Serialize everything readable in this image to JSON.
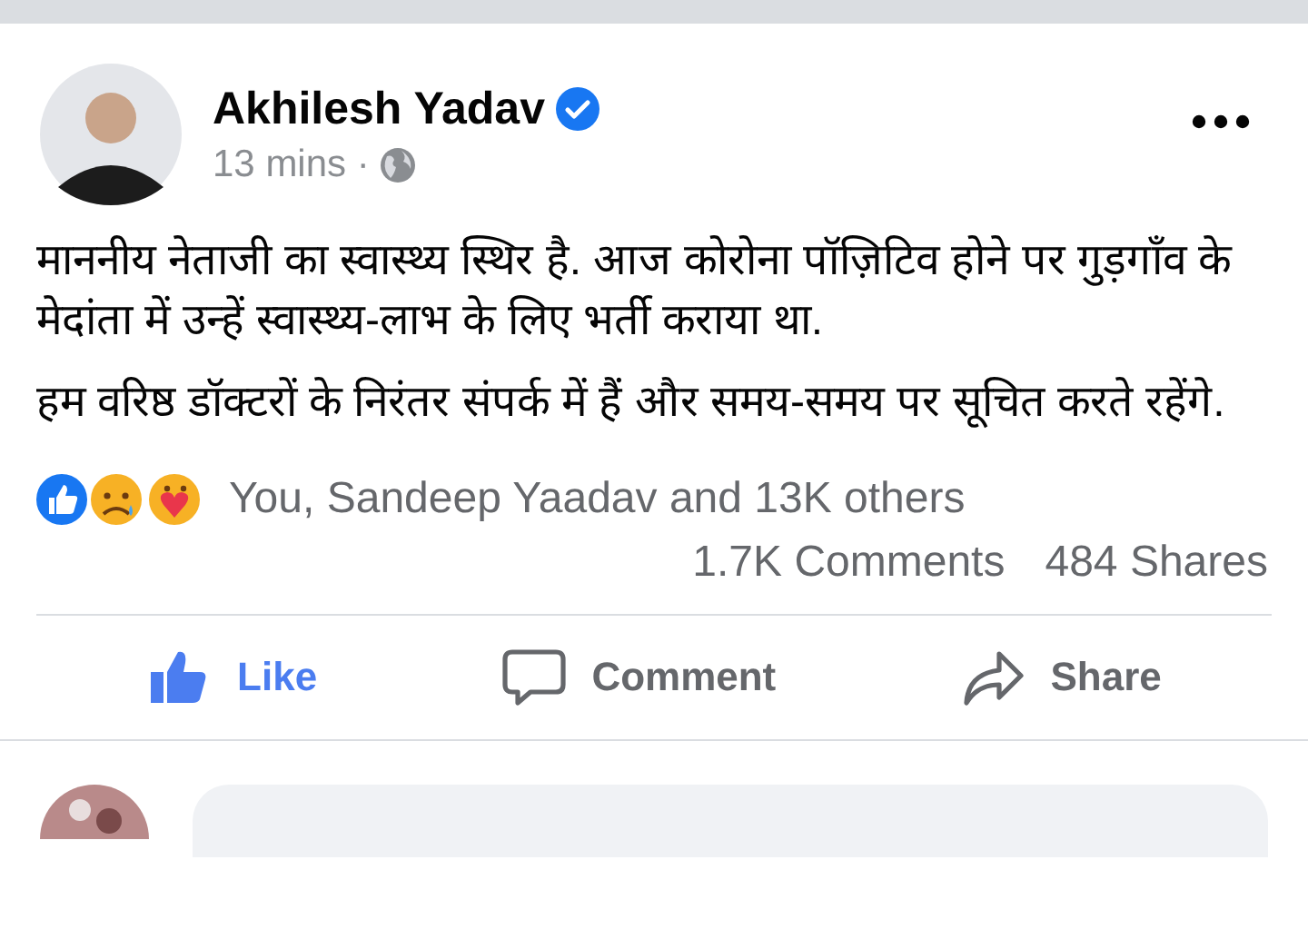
{
  "post": {
    "author": "Akhilesh Yadav",
    "verified": true,
    "time": "13 mins ·",
    "paragraphs": [
      "माननीय नेताजी का स्वास्थ्य स्थिर है. आज कोरोना पॉज़िटिव होने पर गुड़गाँव के मेदांता में उन्हें स्वास्थ्य-लाभ के लिए भर्ती कराया था.",
      "हम वरिष्ठ डॉक्टरों के निरंतर संपर्क में हैं और समय-समय पर सूचित करते रहेंगे."
    ],
    "reactions": "You, Sandeep Yaadav and 13K others",
    "comments": "1.7K Comments",
    "shares": "484 Shares"
  },
  "actions": [
    {
      "kind": "like",
      "label": "Like",
      "selected": true
    },
    {
      "kind": "comment",
      "label": "Comment",
      "selected": false
    },
    {
      "kind": "share",
      "label": "Share",
      "selected": false
    }
  ]
}
